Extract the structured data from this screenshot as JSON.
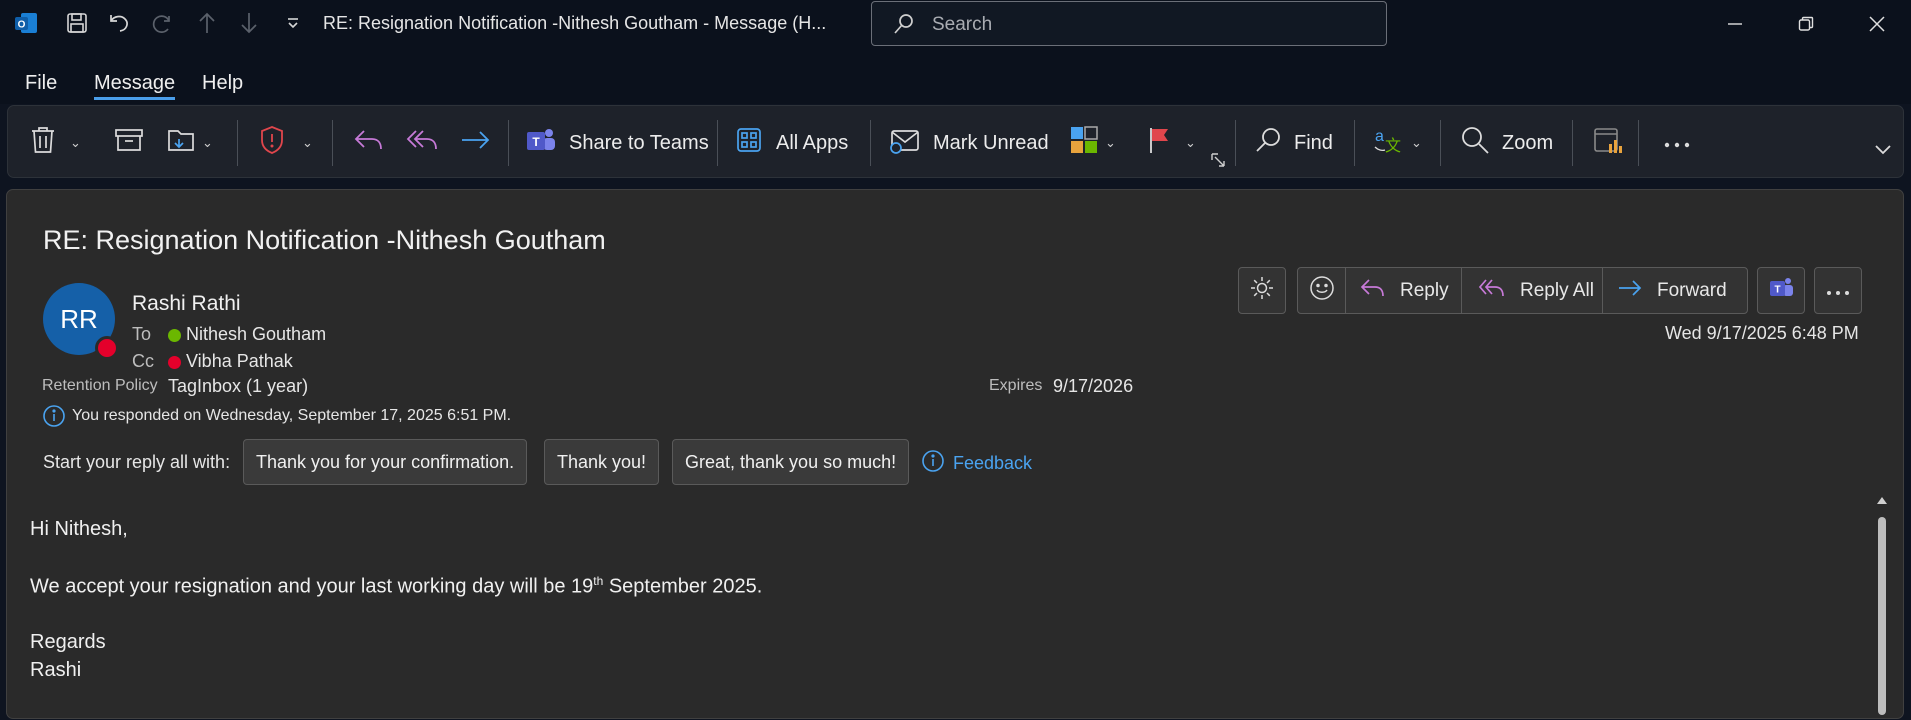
{
  "window": {
    "title": "RE: Resignation Notification -Nithesh Goutham  -  Message (H...",
    "search_placeholder": "Search"
  },
  "menu": {
    "items": [
      "File",
      "Message",
      "Help"
    ],
    "active": "Message"
  },
  "ribbon": {
    "share_to_teams": "Share to Teams",
    "all_apps": "All Apps",
    "mark_unread": "Mark Unread",
    "find": "Find",
    "zoom": "Zoom"
  },
  "message": {
    "subject": "RE: Resignation Notification -Nithesh Goutham",
    "avatar_initials": "RR",
    "sender": "Rashi Rathi",
    "to_label": "To",
    "to": "Nithesh Goutham",
    "cc_label": "Cc",
    "cc": "Vibha Pathak",
    "retention_label": "Retention Policy",
    "retention_value": "TagInbox (1 year)",
    "expires_label": "Expires",
    "expires_value": "9/17/2026",
    "responded_note": "You responded  on Wednesday, September 17, 2025 6:51 PM.",
    "date": "Wed 9/17/2025 6:48 PM",
    "actions": {
      "reply": "Reply",
      "reply_all": "Reply All",
      "forward": "Forward"
    },
    "suggested_label": "Start your reply all with:",
    "suggestions": [
      "Thank you for your confirmation.",
      "Thank you!",
      "Great, thank you so much!"
    ],
    "feedback": "Feedback",
    "body": {
      "greeting": "Hi Nithesh,",
      "line1_pre": "We accept your resignation and your last working day will be 19",
      "line1_sup": "th",
      "line1_post": " September 2025.",
      "regards": "Regards",
      "signature": "Rashi"
    }
  },
  "colors": {
    "accent": "#4a9eea",
    "presence_available": "#6bb700",
    "presence_busy": "#e4002b",
    "avatar_bg": "#1560a8"
  }
}
